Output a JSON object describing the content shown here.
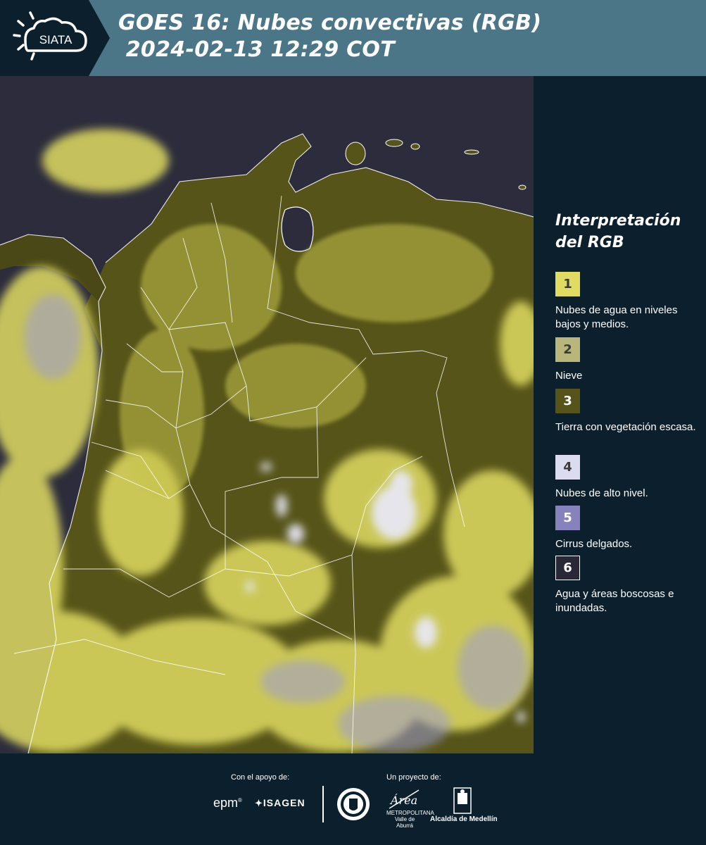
{
  "header": {
    "logo_text": "SIATA",
    "title_line1": "GOES 16: Nubes convectivas (RGB)",
    "title_line2": " 2024-02-13 12:29 COT"
  },
  "legend": {
    "title_line1": "Interpretación",
    "title_line2": "del RGB",
    "items": [
      {
        "number": "1",
        "label": "Nubes de agua en niveles bajos y medios.",
        "color": "#e0dc62"
      },
      {
        "number": "2",
        "label": "Nieve",
        "color": "#b8b67a"
      },
      {
        "number": "3",
        "label": "Tierra con vegetación escasa.",
        "color": "#565418"
      },
      {
        "number": "4",
        "label": "Nubes de alto nivel.",
        "color": "#dcdcf0"
      },
      {
        "number": "5",
        "label": "Cirrus delgados.",
        "color": "#8582bd"
      },
      {
        "number": "6",
        "label": "Agua y áreas boscosas e inundadas.",
        "color": "#2a2838"
      }
    ]
  },
  "footer": {
    "support_label": "Con el apoyo de:",
    "project_label": "Un proyecto de:",
    "sponsor1": "epm",
    "sponsor2": "ISAGEN",
    "area_logo_text": "Área",
    "area_caption": "METROPOLITANA Valle de Aburrá",
    "alcaldia": "Alcaldía de Medellín"
  },
  "colors": {
    "header_bg": "#4a7688",
    "panel_bg": "#0b1f2d",
    "ocean": "#2c2c3c",
    "land": "#565418",
    "low_cloud": "#e0dc62",
    "high_cloud": "#dcdcf0"
  }
}
